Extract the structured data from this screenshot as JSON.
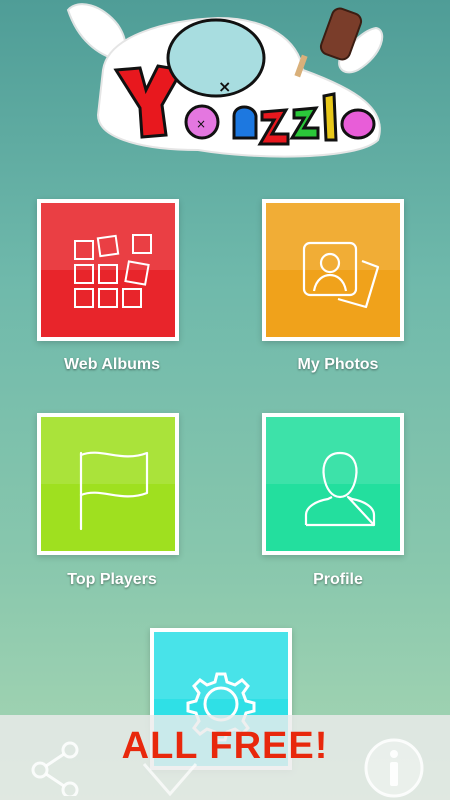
{
  "app": {
    "logo_text": "Yo Puzzle"
  },
  "menu": {
    "items": [
      {
        "label": "Web Albums",
        "icon": "photo-grid-icon",
        "color": "#e8252b"
      },
      {
        "label": "My Photos",
        "icon": "portrait-photos-icon",
        "color": "#f0a21b"
      },
      {
        "label": "Top Players",
        "icon": "flag-icon",
        "color": "#9fe01f"
      },
      {
        "label": "Profile",
        "icon": "person-icon",
        "color": "#23df9e"
      },
      {
        "label": "",
        "icon": "gear-icon",
        "color": "#2fe0e6"
      }
    ]
  },
  "banner": {
    "text": "ALL FREE!",
    "color": "#e8280c"
  },
  "footer": {
    "share_icon": "share-icon",
    "info_icon": "info-icon"
  }
}
